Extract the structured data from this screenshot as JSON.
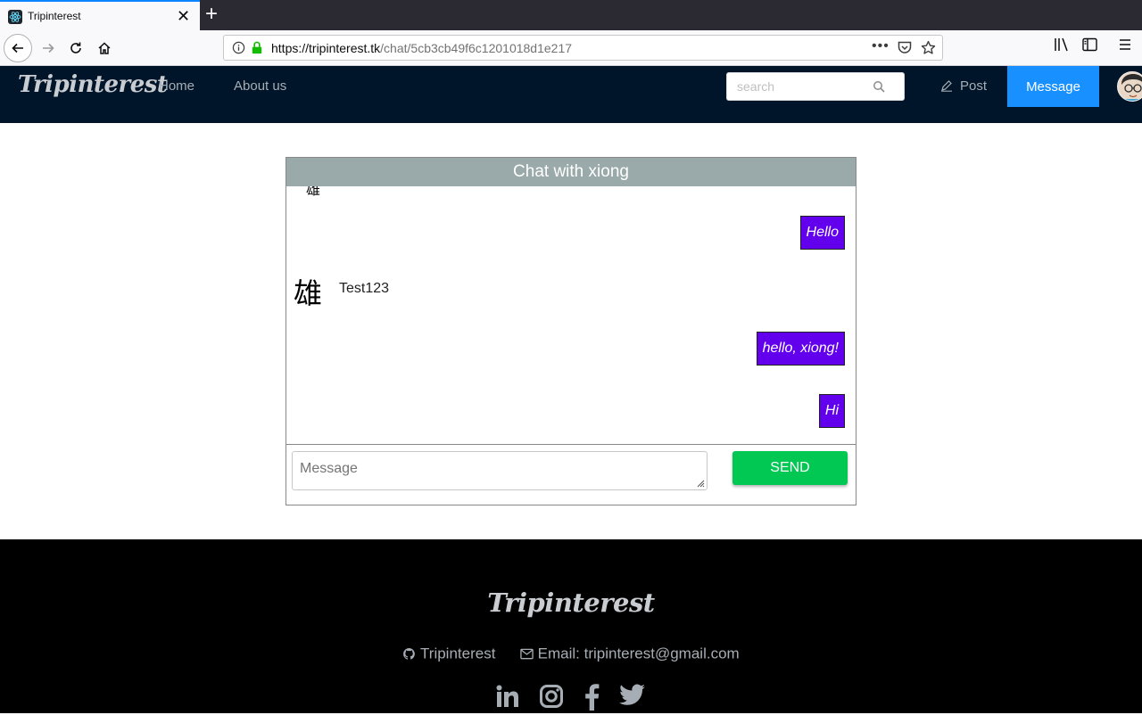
{
  "browser": {
    "tab_title": "Tripinterest",
    "url_host": "https://tripinterest.tk",
    "url_path": "/chat/5cb3cb49f6c1201018d1e217"
  },
  "header": {
    "brand": "Tripinterest",
    "nav": [
      "Home",
      "About us"
    ],
    "search_placeholder": "search",
    "post_label": "Post",
    "message_label": "Message"
  },
  "chat": {
    "title": "Chat with xiong",
    "sender_glyph": "雄",
    "messages": [
      {
        "side": "right",
        "text": "Hello"
      },
      {
        "side": "left",
        "text": "Test123"
      },
      {
        "side": "right",
        "text": "hello, xiong!"
      },
      {
        "side": "right",
        "text": "Hi"
      }
    ],
    "input_placeholder": "Message",
    "send_label": "SEND"
  },
  "footer": {
    "brand": "Tripinterest",
    "github_label": "Tripinterest",
    "email_label": "Email: tripinterest@gmail.com",
    "social_icons": [
      "linkedin-icon",
      "instagram-icon",
      "facebook-icon",
      "twitter-icon"
    ]
  },
  "colors": {
    "header_bg": "#001529",
    "accent_blue": "#1890ff",
    "bubble_purple": "#6200ee",
    "send_green": "#00c853",
    "chat_header_bg": "#9aa9a9"
  }
}
